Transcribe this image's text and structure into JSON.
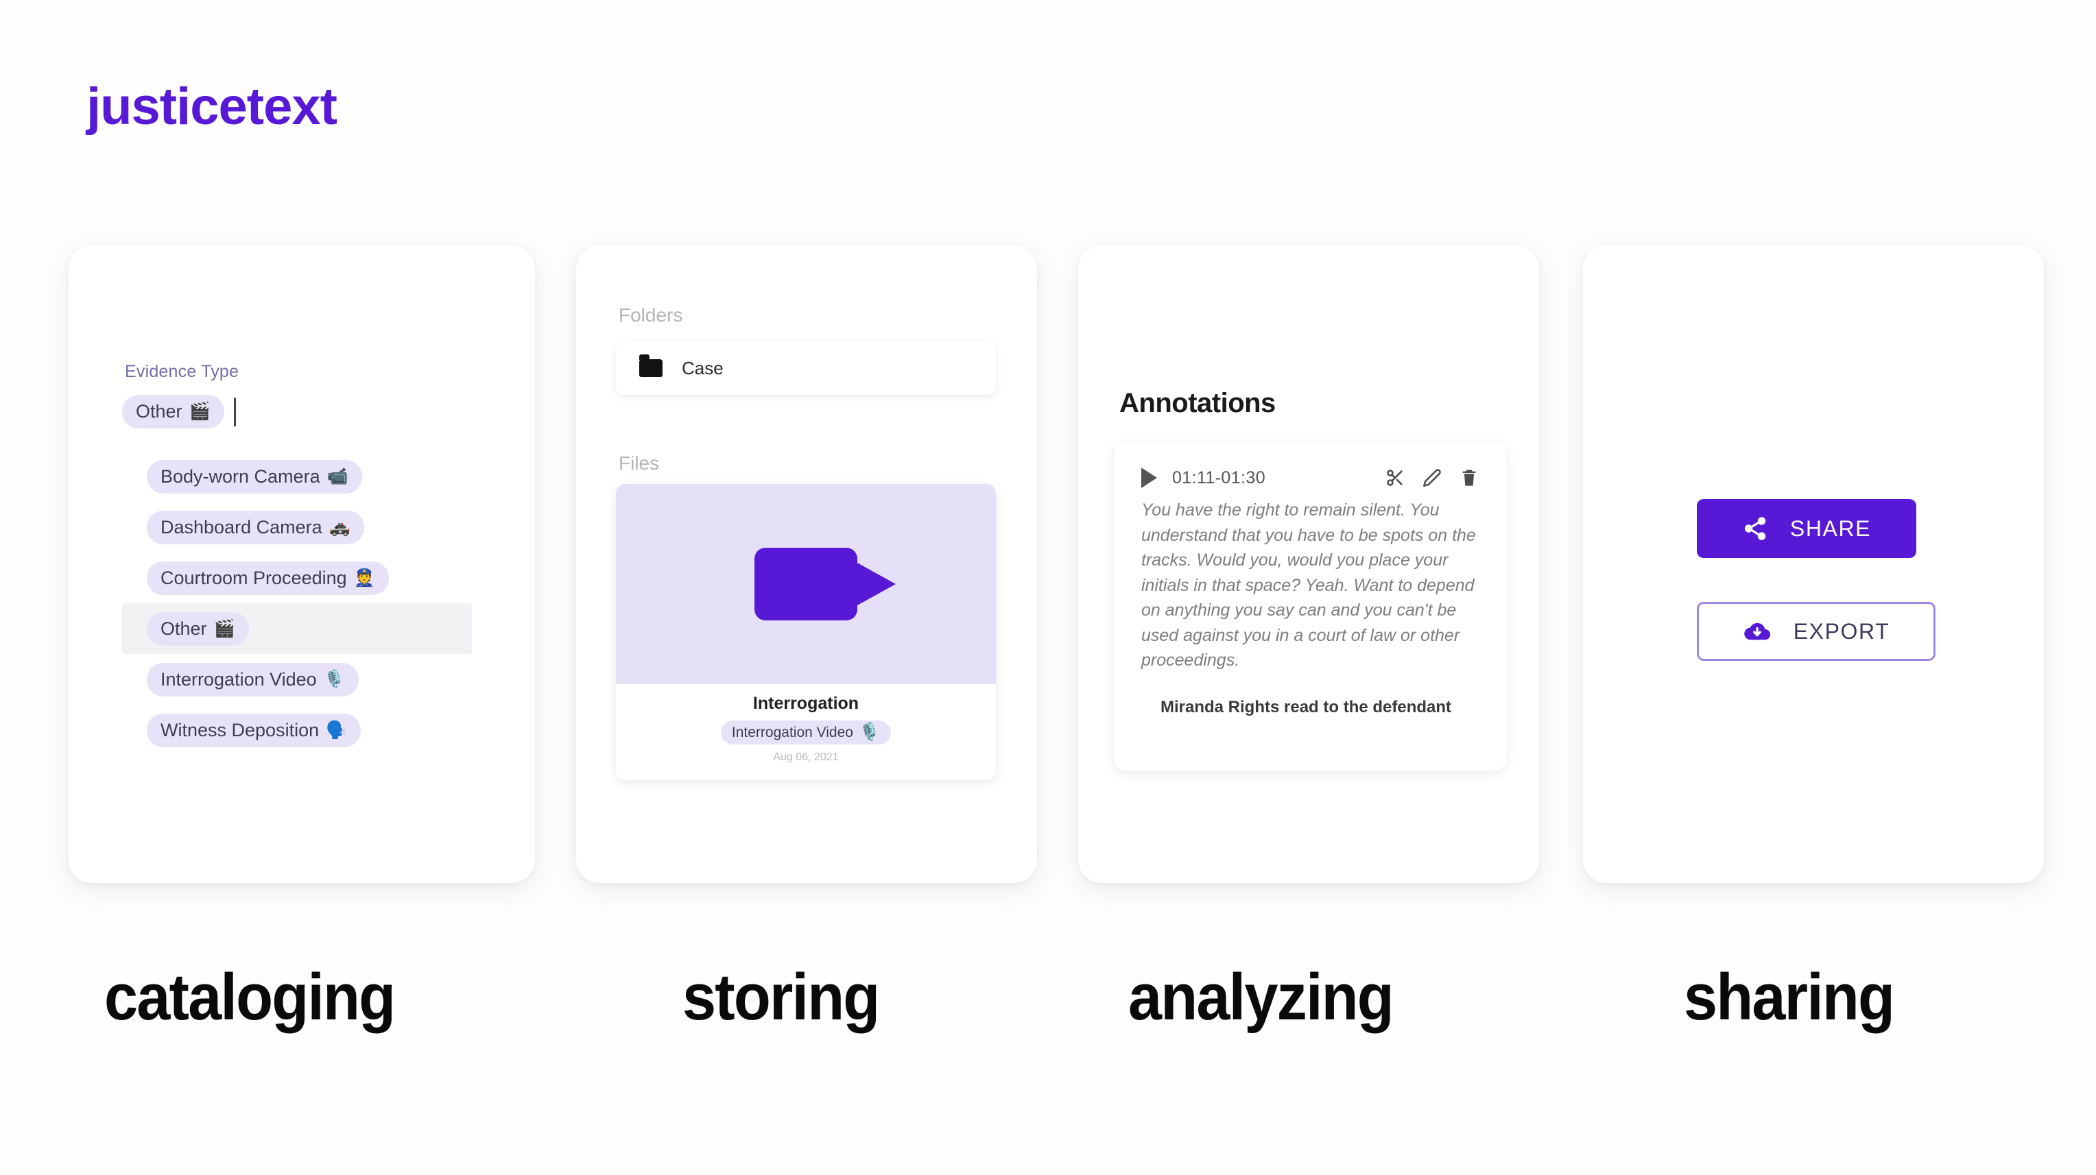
{
  "brand": {
    "logo_text": "justicetext",
    "accent_color": "#5719d6",
    "chip_bg_color": "#e8e2f8",
    "thumb_bg_color": "#e6dff8"
  },
  "cataloging_card": {
    "field_label": "Evidence Type",
    "selected_chip": "Other",
    "selected_chip_emoji": "🎬",
    "options": [
      {
        "label": "Body-worn Camera",
        "emoji": "📹",
        "hovered": false
      },
      {
        "label": "Dashboard Camera",
        "emoji": "🚓",
        "hovered": false
      },
      {
        "label": "Courtroom Proceeding",
        "emoji": "👮",
        "hovered": false
      },
      {
        "label": "Other",
        "emoji": "🎬",
        "hovered": true
      },
      {
        "label": "Interrogation Video",
        "emoji": "🎙️",
        "hovered": false
      },
      {
        "label": "Witness Deposition",
        "emoji": "🗣️",
        "hovered": false
      }
    ]
  },
  "storing_card": {
    "folders_label": "Folders",
    "folder_name": "Case",
    "files_label": "Files",
    "file": {
      "title": "Interrogation",
      "tag": "Interrogation Video",
      "tag_emoji": "🎙️",
      "date": "Aug 06, 2021"
    }
  },
  "analyzing_card": {
    "title": "Annotations",
    "annotation": {
      "timecode": "01:11-01:30",
      "transcript": "You have the right to remain silent. You understand that you have to be spots on the tracks. Would you, would you place your initials in that space? Yeah. Want to depend on anything you say can and you can't be used against you in a court of law or other proceedings.",
      "note": "Miranda Rights read to the defendant"
    }
  },
  "sharing_card": {
    "share_label": "SHARE",
    "export_label": "EXPORT"
  },
  "captions": {
    "cataloging": "cataloging",
    "storing": "storing",
    "analyzing": "analyzing",
    "sharing": "sharing"
  }
}
